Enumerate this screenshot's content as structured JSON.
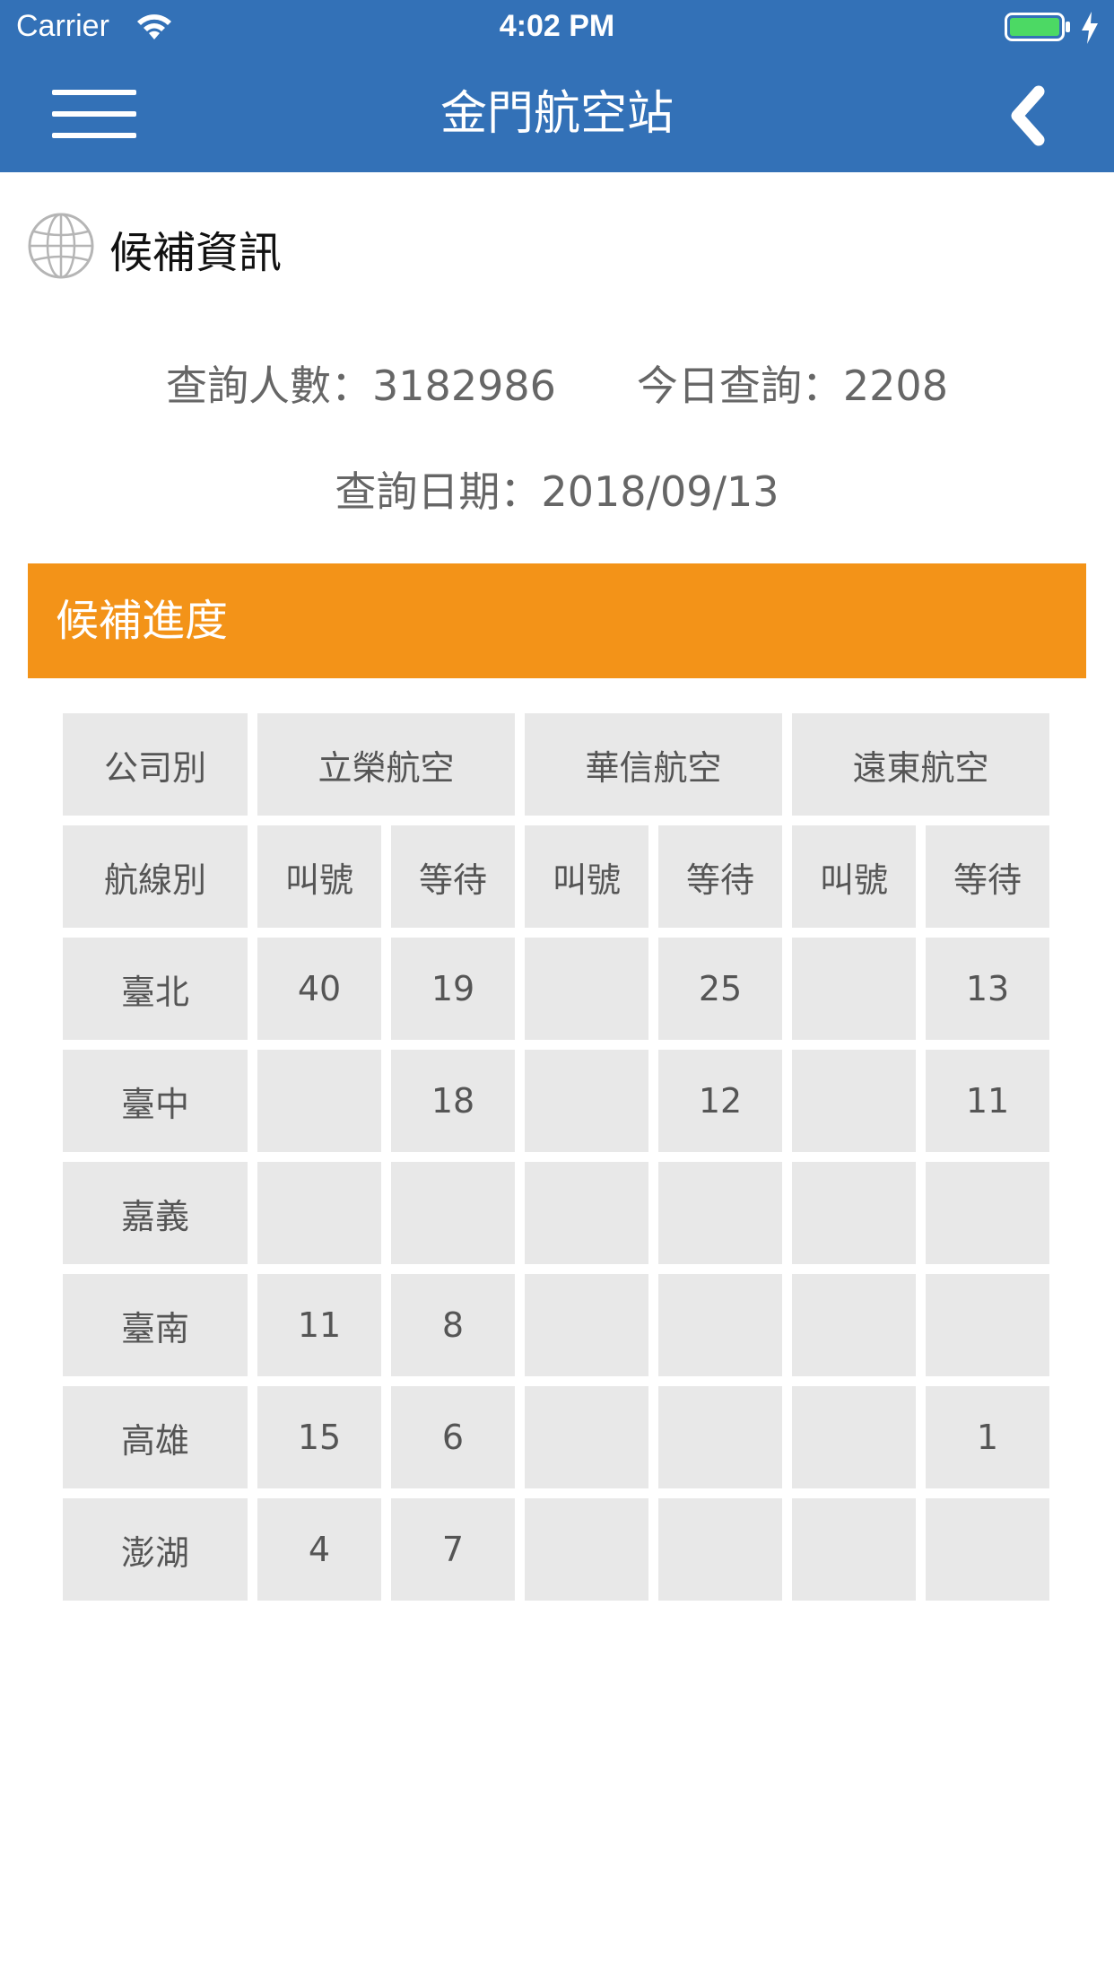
{
  "status_bar": {
    "carrier": "Carrier",
    "time": "4:02 PM"
  },
  "nav": {
    "title": "金門航空站",
    "menu_icon": "hamburger-menu-icon",
    "back_icon": "chevron-left-icon"
  },
  "section": {
    "icon": "globe-icon",
    "title": "候補資訊"
  },
  "stats": {
    "total_label": "查詢人數：",
    "total_value": "3182986",
    "today_label": "今日查詢：",
    "today_value": "2208",
    "date_label": "查詢日期：",
    "date_value": "2018/09/13"
  },
  "progress_header": "候補進度",
  "table": {
    "company_header": "公司別",
    "route_header": "航線別",
    "airlines": [
      "立榮航空",
      "華信航空",
      "遠東航空"
    ],
    "sub_headers": [
      "叫號",
      "等待",
      "叫號",
      "等待",
      "叫號",
      "等待"
    ],
    "rows": [
      {
        "route": "臺北",
        "values": [
          "40",
          "19",
          "",
          "25",
          "",
          "13"
        ]
      },
      {
        "route": "臺中",
        "values": [
          "",
          "18",
          "",
          "12",
          "",
          "11"
        ]
      },
      {
        "route": "嘉義",
        "values": [
          "",
          "",
          "",
          "",
          "",
          ""
        ]
      },
      {
        "route": "臺南",
        "values": [
          "11",
          "8",
          "",
          "",
          "",
          ""
        ]
      },
      {
        "route": "高雄",
        "values": [
          "15",
          "6",
          "",
          "",
          "",
          "1"
        ]
      },
      {
        "route": "澎湖",
        "values": [
          "4",
          "7",
          "",
          "",
          "",
          ""
        ]
      }
    ]
  },
  "colors": {
    "nav_bg": "#3371b7",
    "accent_orange": "#f39318",
    "cell_bg": "#e8e8e8",
    "battery_green": "#4cd964"
  }
}
